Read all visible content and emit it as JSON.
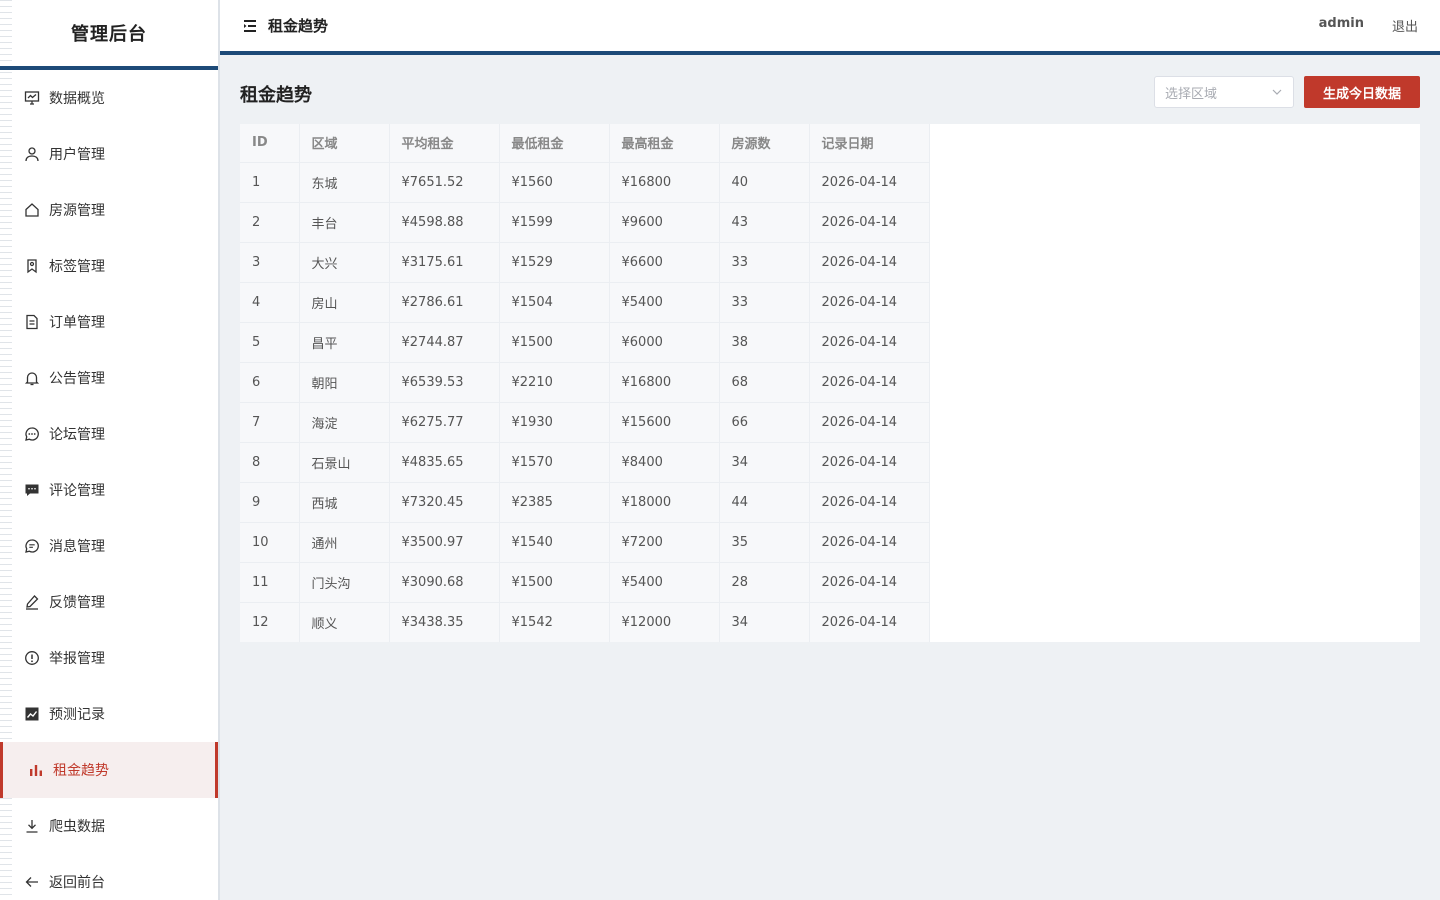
{
  "sidebar": {
    "brand": "管理后台",
    "items": [
      {
        "label": "数据概览",
        "icon": "monitor-chart-icon",
        "active": false
      },
      {
        "label": "用户管理",
        "icon": "user-icon",
        "active": false
      },
      {
        "label": "房源管理",
        "icon": "house-icon",
        "active": false
      },
      {
        "label": "标签管理",
        "icon": "tag-icon",
        "active": false
      },
      {
        "label": "订单管理",
        "icon": "document-icon",
        "active": false
      },
      {
        "label": "公告管理",
        "icon": "bell-icon",
        "active": false
      },
      {
        "label": "论坛管理",
        "icon": "chat-dots-icon",
        "active": false
      },
      {
        "label": "评论管理",
        "icon": "comment-filled-icon",
        "active": false
      },
      {
        "label": "消息管理",
        "icon": "message-icon",
        "active": false
      },
      {
        "label": "反馈管理",
        "icon": "edit-pen-icon",
        "active": false
      },
      {
        "label": "举报管理",
        "icon": "warning-circle-icon",
        "active": false
      },
      {
        "label": "预测记录",
        "icon": "trend-chart-icon",
        "active": false
      },
      {
        "label": "租金趋势",
        "icon": "bar-chart-icon",
        "active": true
      },
      {
        "label": "爬虫数据",
        "icon": "download-icon",
        "active": false
      },
      {
        "label": "返回前台",
        "icon": "arrow-left-icon",
        "active": false
      }
    ]
  },
  "topbar": {
    "title": "租金趋势",
    "user": "admin",
    "logout": "退出"
  },
  "main": {
    "title": "租金趋势",
    "region_placeholder": "选择区域",
    "generate_button": "生成今日数据",
    "table": {
      "headers": [
        "ID",
        "区域",
        "平均租金",
        "最低租金",
        "最高租金",
        "房源数",
        "记录日期"
      ],
      "rows": [
        [
          "1",
          "东城",
          "¥7651.52",
          "¥1560",
          "¥16800",
          "40",
          "2026-04-14"
        ],
        [
          "2",
          "丰台",
          "¥4598.88",
          "¥1599",
          "¥9600",
          "43",
          "2026-04-14"
        ],
        [
          "3",
          "大兴",
          "¥3175.61",
          "¥1529",
          "¥6600",
          "33",
          "2026-04-14"
        ],
        [
          "4",
          "房山",
          "¥2786.61",
          "¥1504",
          "¥5400",
          "33",
          "2026-04-14"
        ],
        [
          "5",
          "昌平",
          "¥2744.87",
          "¥1500",
          "¥6000",
          "38",
          "2026-04-14"
        ],
        [
          "6",
          "朝阳",
          "¥6539.53",
          "¥2210",
          "¥16800",
          "68",
          "2026-04-14"
        ],
        [
          "7",
          "海淀",
          "¥6275.77",
          "¥1930",
          "¥15600",
          "66",
          "2026-04-14"
        ],
        [
          "8",
          "石景山",
          "¥4835.65",
          "¥1570",
          "¥8400",
          "34",
          "2026-04-14"
        ],
        [
          "9",
          "西城",
          "¥7320.45",
          "¥2385",
          "¥18000",
          "44",
          "2026-04-14"
        ],
        [
          "10",
          "通州",
          "¥3500.97",
          "¥1540",
          "¥7200",
          "35",
          "2026-04-14"
        ],
        [
          "11",
          "门头沟",
          "¥3090.68",
          "¥1500",
          "¥5400",
          "28",
          "2026-04-14"
        ],
        [
          "12",
          "顺义",
          "¥3438.35",
          "¥1542",
          "¥12000",
          "34",
          "2026-04-14"
        ]
      ]
    }
  },
  "colors": {
    "accent": "#c0392b",
    "header_border": "#1d4a78"
  }
}
